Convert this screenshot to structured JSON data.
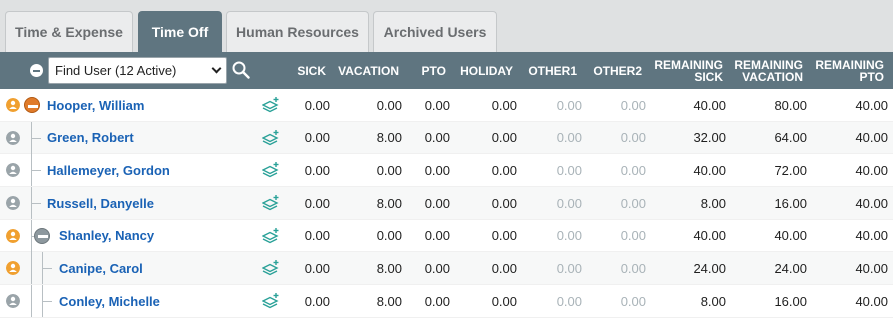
{
  "tabs": [
    {
      "label": "Time & Expense",
      "active": false
    },
    {
      "label": "Time Off",
      "active": true
    },
    {
      "label": "Human Resources",
      "active": false
    },
    {
      "label": "Archived Users",
      "active": false
    }
  ],
  "toolbar": {
    "find_user_selected": "Find User (12 Active)"
  },
  "columns": {
    "sick": "SICK",
    "vacation": "VACATION",
    "pto": "PTO",
    "holiday": "HOLIDAY",
    "other1": "OTHER1",
    "other2": "OTHER2",
    "remaining_sick": [
      "REMAINING",
      "SICK"
    ],
    "remaining_vacation": [
      "REMAINING",
      "VACATION"
    ],
    "remaining_pto": [
      "REMAINING",
      "PTO"
    ]
  },
  "colors": {
    "header_bg": "#5f7580",
    "link": "#1a62b5",
    "active_user": "#f0a030",
    "inactive_user": "#9aa4a9",
    "layers_icon": "#2aa198",
    "tree_active": "#e07b2a",
    "tree_inactive": "#8d989e"
  },
  "rows": [
    {
      "name": "Hooper, William",
      "status": "active",
      "tree": "expanded-active",
      "sick": "0.00",
      "vacation": "0.00",
      "pto": "0.00",
      "holiday": "0.00",
      "other1": "0.00",
      "other2": "0.00",
      "remaining_sick": "40.00",
      "remaining_vacation": "80.00",
      "remaining_pto": "40.00"
    },
    {
      "name": "Green, Robert",
      "status": "inactive",
      "tree": "child",
      "sick": "0.00",
      "vacation": "8.00",
      "pto": "0.00",
      "holiday": "0.00",
      "other1": "0.00",
      "other2": "0.00",
      "remaining_sick": "32.00",
      "remaining_vacation": "64.00",
      "remaining_pto": "40.00"
    },
    {
      "name": "Hallemeyer, Gordon",
      "status": "inactive",
      "tree": "child",
      "sick": "0.00",
      "vacation": "0.00",
      "pto": "0.00",
      "holiday": "0.00",
      "other1": "0.00",
      "other2": "0.00",
      "remaining_sick": "40.00",
      "remaining_vacation": "72.00",
      "remaining_pto": "40.00"
    },
    {
      "name": "Russell, Danyelle",
      "status": "inactive",
      "tree": "child",
      "sick": "0.00",
      "vacation": "8.00",
      "pto": "0.00",
      "holiday": "0.00",
      "other1": "0.00",
      "other2": "0.00",
      "remaining_sick": "8.00",
      "remaining_vacation": "16.00",
      "remaining_pto": "40.00"
    },
    {
      "name": "Shanley, Nancy",
      "status": "active",
      "tree": "expanded-child",
      "sick": "0.00",
      "vacation": "0.00",
      "pto": "0.00",
      "holiday": "0.00",
      "other1": "0.00",
      "other2": "0.00",
      "remaining_sick": "40.00",
      "remaining_vacation": "40.00",
      "remaining_pto": "40.00"
    },
    {
      "name": "Canipe, Carol",
      "status": "active",
      "tree": "grandchild",
      "sick": "0.00",
      "vacation": "8.00",
      "pto": "0.00",
      "holiday": "0.00",
      "other1": "0.00",
      "other2": "0.00",
      "remaining_sick": "24.00",
      "remaining_vacation": "24.00",
      "remaining_pto": "40.00"
    },
    {
      "name": "Conley, Michelle",
      "status": "inactive",
      "tree": "grandchild",
      "sick": "0.00",
      "vacation": "8.00",
      "pto": "0.00",
      "holiday": "0.00",
      "other1": "0.00",
      "other2": "0.00",
      "remaining_sick": "8.00",
      "remaining_vacation": "16.00",
      "remaining_pto": "40.00"
    }
  ]
}
